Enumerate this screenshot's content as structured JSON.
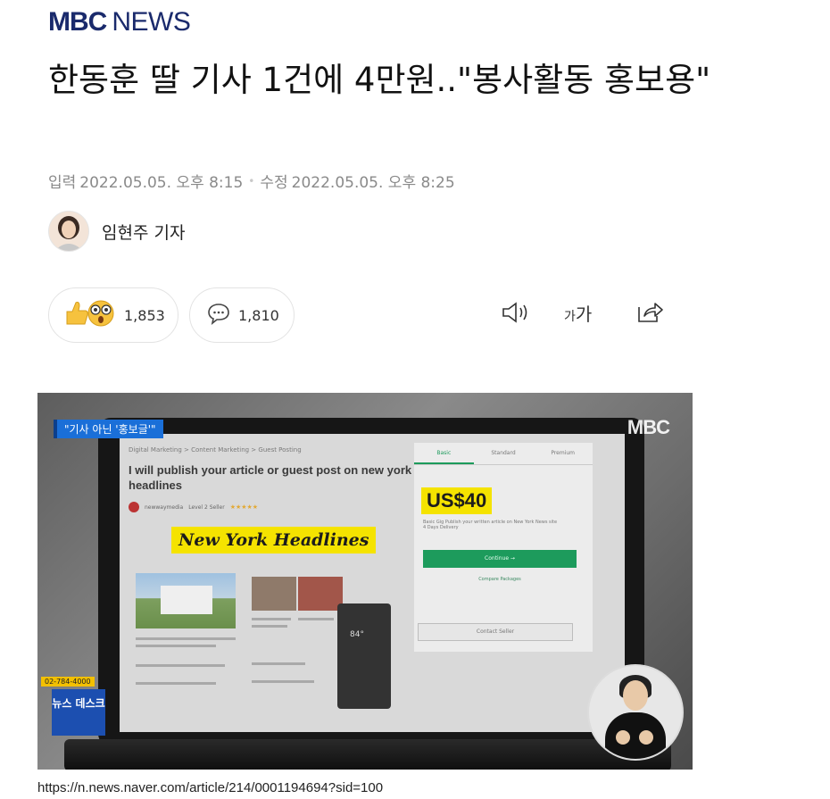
{
  "header": {
    "logo_mbc": "MBC",
    "logo_news": "NEWS"
  },
  "article": {
    "headline": "한동훈 딸 기사 1건에 4만원..\"봉사활동 홍보용\"",
    "input_label": "입력",
    "input_date": "2022.05.05. 오후 8:15",
    "modified_label": "수정",
    "modified_date": "2022.05.05. 오후 8:25",
    "reporter": "임현주 기자"
  },
  "actions": {
    "like_count": "1,853",
    "comment_count": "1,810",
    "font_size_small": "가",
    "font_size_large": "가"
  },
  "video": {
    "caption_tag": "\"기사 아닌 '홍보글'\"",
    "watermark": "MBC",
    "breadcrumb": "Digital Marketing > Content Marketing > Guest Posting",
    "gig_title": "I will publish your article or guest post on new york headlines",
    "seller_name": "newwaymedia",
    "seller_level": "Level 2 Seller",
    "stars": "★★★★★",
    "nyh_label": "New York Headlines",
    "tabs": [
      "Basic",
      "Standard",
      "Premium"
    ],
    "price": "US$40",
    "price_text": "Basic Gig Publish your written article on New York News site",
    "delivery": "4 Days Delivery",
    "continue_label": "Continue →",
    "compare_label": "Compare Packages",
    "contact_label": "Contact Seller",
    "phone_number": "02-784-4000",
    "desk_badge": "뉴스 데스크",
    "phone_temp": "84°"
  },
  "footer": {
    "url": "https://n.news.naver.com/article/214/0001194694?sid=100"
  }
}
